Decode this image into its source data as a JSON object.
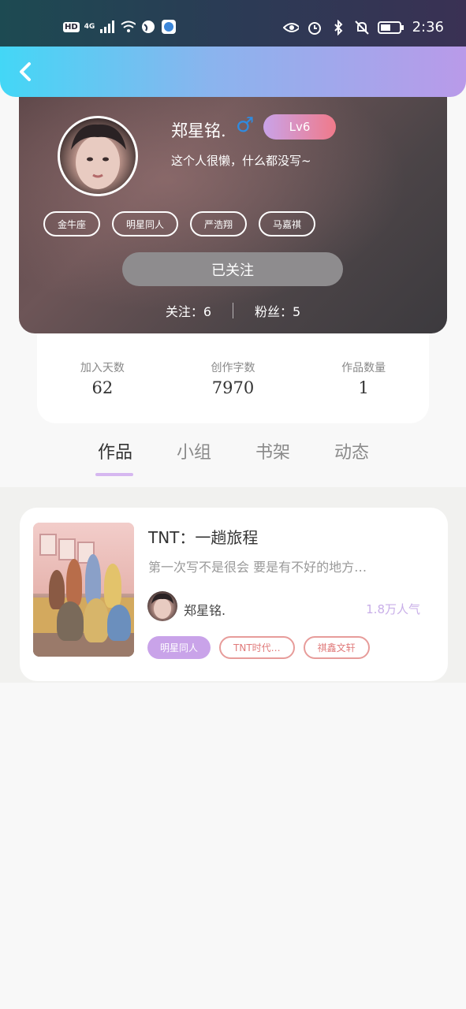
{
  "status_bar": {
    "hd": "HD",
    "network": "4G",
    "time": "2:36"
  },
  "profile": {
    "username": "郑星铭.",
    "gender_symbol": "♂",
    "level": "Lv6",
    "bio": "这个人很懒，什么都没写~",
    "tags": [
      "金牛座",
      "明星同人",
      "严浩翔",
      "马嘉祺"
    ],
    "follow_button": "已关注",
    "following_label": "关注：6",
    "followers_label": "粉丝：5"
  },
  "stats": [
    {
      "label": "加入天数",
      "value": "62"
    },
    {
      "label": "创作字数",
      "value": "7970"
    },
    {
      "label": "作品数量",
      "value": "1"
    }
  ],
  "tabs": [
    "作品",
    "小组",
    "书架",
    "动态"
  ],
  "active_tab": 0,
  "work": {
    "title": "TNT：一趟旅程",
    "description": "第一次写不是很会  要是有不好的地方…",
    "author": "郑星铭.",
    "popularity": "1.8万人气",
    "tags": [
      "明星同人",
      "TNT时代…",
      "祺鑫文轩"
    ]
  },
  "colors": {
    "header_gradient_start": "#43d7f6",
    "header_gradient_end": "#b99ae9",
    "accent_purple": "#c9a3e9",
    "gender_blue": "#2f8be0",
    "tag_outline": "#e79c9a"
  }
}
